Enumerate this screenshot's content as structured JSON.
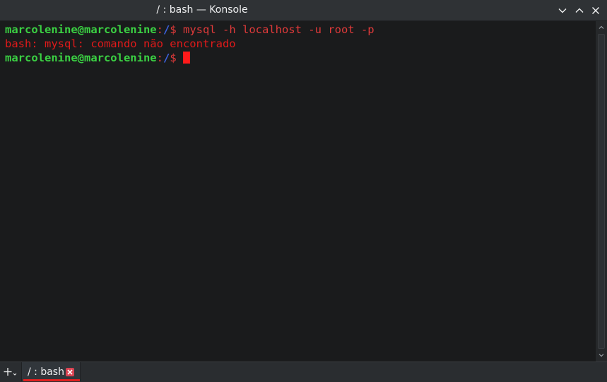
{
  "window": {
    "title": "/ : bash — Konsole"
  },
  "terminal": {
    "lines": [
      {
        "user_host": "marcolenine@marcolenine",
        "separator": ":",
        "path": "/",
        "prompt": "$",
        "command": " mysql -h localhost -u root -p"
      },
      {
        "output": "bash: mysql: comando não encontrado"
      },
      {
        "user_host": "marcolenine@marcolenine",
        "separator": ":",
        "path": "/",
        "prompt": "$",
        "command": ""
      }
    ]
  },
  "tabs": [
    {
      "label": "/ : bash",
      "active": true
    }
  ],
  "colors": {
    "user": "#3bd143",
    "path": "#3d63e3",
    "error": "#e01a1a",
    "cursor": "#ff1a1a",
    "tab_accent": "#e0201f"
  },
  "icons": {
    "minimize": "chevron-down-icon",
    "maximize": "chevron-up-icon",
    "close": "close-icon",
    "new_tab": "new-tab-icon",
    "tab_close": "tab-close-icon"
  }
}
